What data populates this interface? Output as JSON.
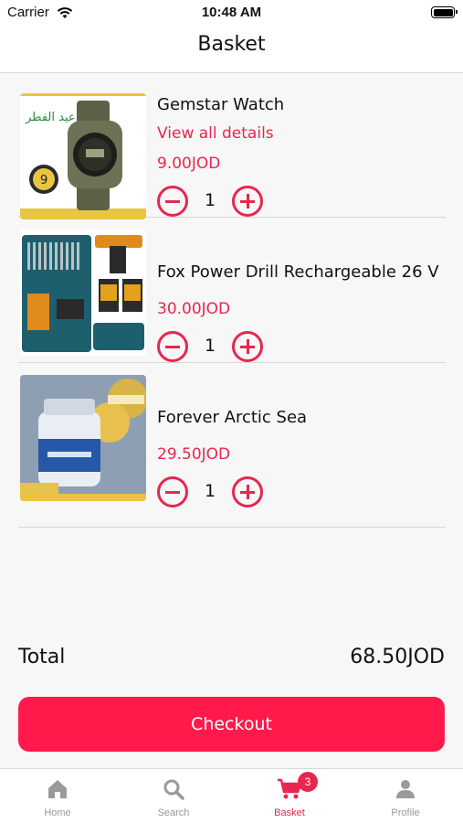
{
  "status_bar": {
    "carrier": "Carrier",
    "time": "10:48 AM"
  },
  "nav": {
    "title": "Basket"
  },
  "items": [
    {
      "name": "Gemstar Watch",
      "details_link": "View all details",
      "price": "9.00JOD",
      "qty": "1",
      "image": "watch-product-image"
    },
    {
      "name": "Fox Power Drill Rechargeable 26 V",
      "price": "30.00JOD",
      "qty": "1",
      "image": "drill-kit-product-image"
    },
    {
      "name": "Forever Arctic Sea",
      "price": "29.50JOD",
      "qty": "1",
      "image": "supplement-bottle-product-image"
    }
  ],
  "summary": {
    "total_label": "Total",
    "total_value": "68.50JOD"
  },
  "checkout_label": "Checkout",
  "tabbar": {
    "tabs": [
      {
        "label": "Home",
        "icon": "home-icon"
      },
      {
        "label": "Search",
        "icon": "search-icon"
      },
      {
        "label": "Basket",
        "icon": "cart-icon",
        "badge": "3",
        "active": true
      },
      {
        "label": "Profile",
        "icon": "person-icon"
      }
    ]
  },
  "colors": {
    "accent": "#e8264f",
    "checkout": "#ff1a4b",
    "inactive_tab": "#9a9a9a"
  }
}
